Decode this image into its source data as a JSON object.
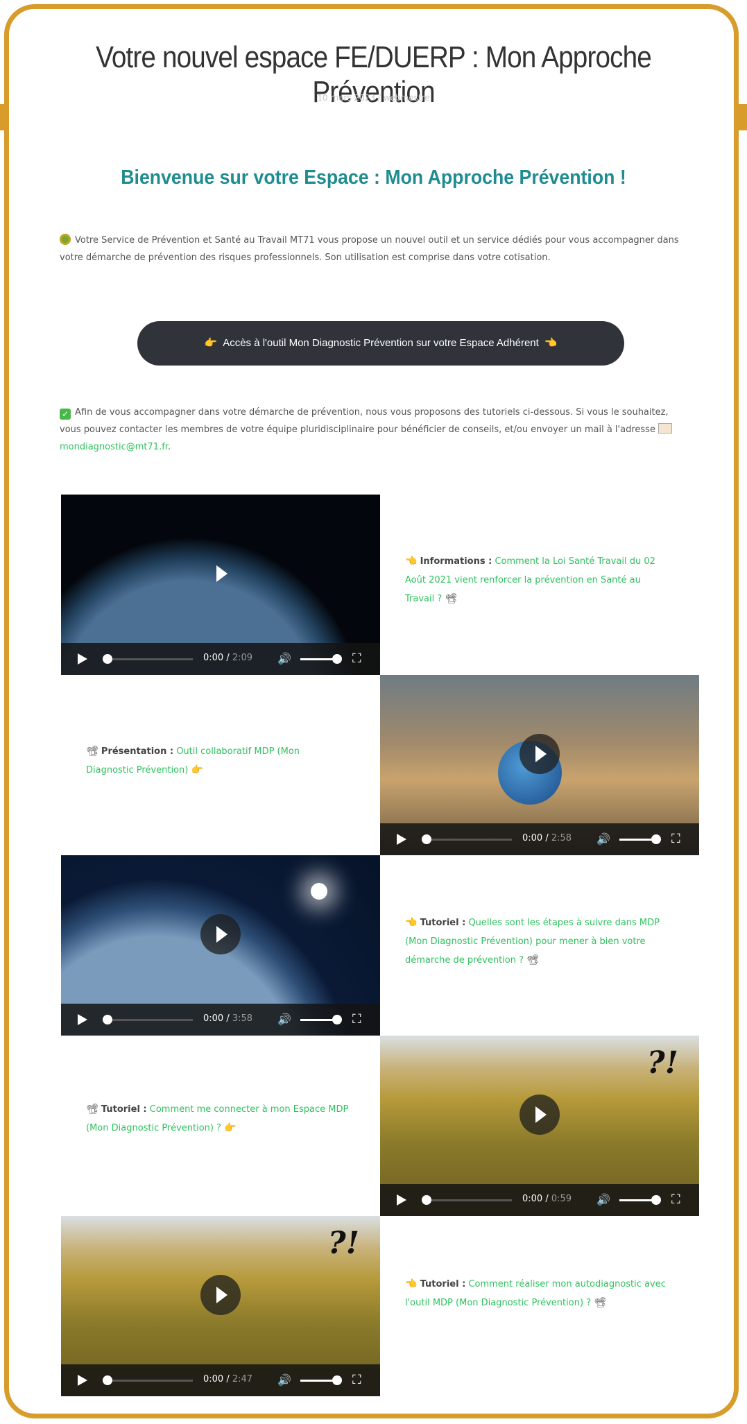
{
  "header": {
    "title": "Votre nouvel espace FE/DUERP : Mon Approche Prévention",
    "meta": "10 mars 2023 / webmestre"
  },
  "welcome": "Bienvenue sur votre Espace : Mon Approche Prévention !",
  "intro": "Votre Service de Prévention et Santé au Travail MT71 vous propose un nouvel outil et un service dédiés pour vous accompagner dans votre démarche de prévention des risques professionnels. Son utilisation est comprise dans votre cotisation.",
  "cta": {
    "label": "Accès à l'outil Mon Diagnostic Prévention sur votre Espace Adhérent",
    "hand_left": "👉",
    "hand_right": "👈"
  },
  "support": {
    "text": "Afin de vous accompagner dans votre démarche de prévention, nous vous proposons des tutoriels ci-dessous. Si vous le souhaitez, vous pouvez contacter les membres de votre équipe pluridisciplinaire pour bénéficier de conseils, et/ou envoyer un mail à l'adresse",
    "email": "mondiagnostic@mt71.fr",
    "suffix": "."
  },
  "videos": [
    {
      "category": "Informations :",
      "link": "Comment la Loi Santé Travail du 02 Août 2021 vient renforcer la prévention en Santé au Travail ?",
      "icon_before": "👈",
      "icon_after": "📽",
      "time": "0:00",
      "duration": "2:09"
    },
    {
      "category": "Présentation :",
      "link": "Outil collaboratif MDP (Mon Diagnostic Prévention)",
      "icon_before": "📽",
      "icon_after": "👉",
      "time": "0:00",
      "duration": "2:58"
    },
    {
      "category": "Tutoriel :",
      "link": "Quelles sont les étapes à suivre dans MDP (Mon Diagnostic Prévention) pour mener à bien votre démarche de prévention ?",
      "icon_before": "👈",
      "icon_after": "📽",
      "time": "0:00",
      "duration": "3:58"
    },
    {
      "category": "Tutoriel :",
      "link": "Comment me connecter à mon Espace MDP (Mon Diagnostic Prévention) ?",
      "icon_before": "📽",
      "icon_after": "👉",
      "time": "0:00",
      "duration": "0:59"
    },
    {
      "category": "Tutoriel :",
      "link": "Comment réaliser mon autodiagnostic avec l'outil MDP (Mon Diagnostic Prévention) ?",
      "icon_before": "👈",
      "icon_after": "📽",
      "time": "0:00",
      "duration": "2:47"
    }
  ],
  "video_overlay_text": "?!"
}
